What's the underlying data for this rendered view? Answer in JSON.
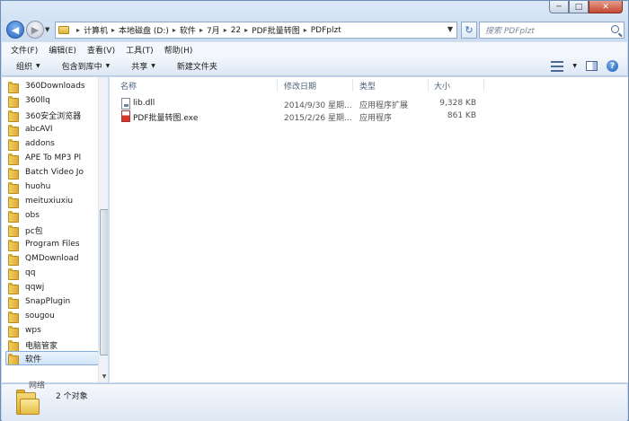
{
  "window": {
    "caption": {
      "minimize": "─",
      "maximize": "□",
      "close": "✕"
    }
  },
  "nav": {
    "back_glyph": "◀",
    "forward_glyph": "▶",
    "dropdown_glyph": "▼",
    "breadcrumb": [
      "计算机",
      "本地磁盘 (D:)",
      "软件",
      "7月",
      "22",
      "PDF批量转图",
      "PDFplzt"
    ],
    "separator": "▸",
    "refresh_glyph": "↻",
    "search_placeholder": "搜索 PDFplzt"
  },
  "menubar": {
    "items": [
      "文件(F)",
      "编辑(E)",
      "查看(V)",
      "工具(T)",
      "帮助(H)"
    ]
  },
  "commandbar": {
    "organize": "组织",
    "include_in_library": "包含到库中",
    "share": "共享",
    "new_folder": "新建文件夹",
    "caret": "▼",
    "help_glyph": "?"
  },
  "tree": {
    "items": [
      "360Downloads",
      "360llq",
      "360安全浏览器",
      "abcAVI",
      "addons",
      "APE To MP3 Pl",
      "Batch Video Jo",
      "huohu",
      "meituxiuxiu",
      "obs",
      "pc包",
      "Program Files",
      "QMDownload",
      "qq",
      "qqwj",
      "SnapPlugin",
      "sougou",
      "wps",
      "电脑管家",
      "软件"
    ],
    "selected": "软件",
    "scroll_down_glyph": "▼"
  },
  "columns": {
    "name": "名称",
    "modified": "修改日期",
    "type": "类型",
    "size": "大小"
  },
  "files": [
    {
      "name": "lib.dll",
      "modified": "2014/9/30 星期...",
      "type": "应用程序扩展",
      "size": "9,328 KB",
      "icon": "dll-file-icon"
    },
    {
      "name": "PDF批量转图.exe",
      "modified": "2015/2/26 星期...",
      "type": "应用程序",
      "size": "861 KB",
      "icon": "exe-file-icon"
    }
  ],
  "details": {
    "count": "2 个对象",
    "cut_label": "网络"
  }
}
